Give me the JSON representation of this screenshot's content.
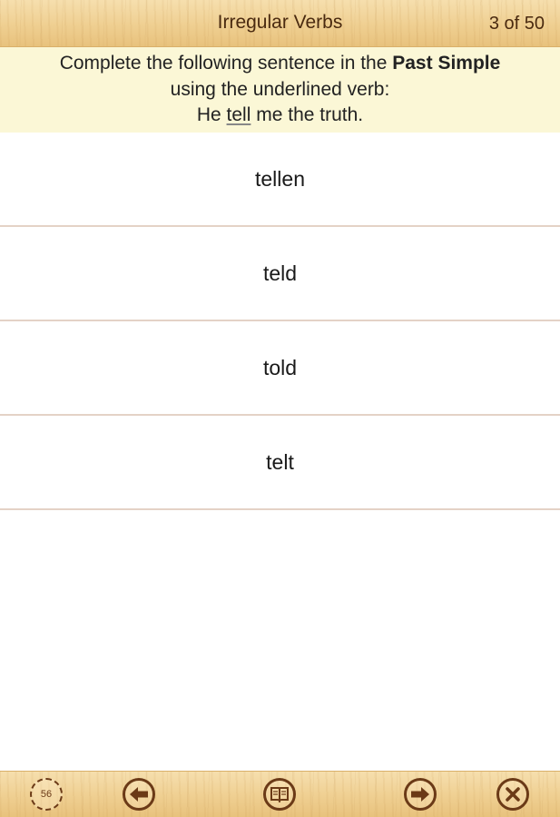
{
  "header": {
    "title": "Irregular Verbs",
    "counter": "3 of 50"
  },
  "question": {
    "prefix": "Complete the following sentence in the ",
    "tense": "Past Simple",
    "line2": "using the underlined verb:",
    "sentence_before": "He ",
    "verb": "tell",
    "sentence_after": " me the truth."
  },
  "answers": [
    "tellen",
    "teld",
    "told",
    "telt"
  ],
  "toolbar": {
    "timer_value": "56",
    "icons": [
      "timer-icon",
      "back-arrow-icon",
      "book-icon",
      "forward-arrow-icon",
      "close-icon"
    ]
  },
  "colors": {
    "wood_light": "#f6dfae",
    "wood_dark": "#e8c27d",
    "question_bg": "#fbf7d6",
    "icon_brown": "#6b3a17",
    "divider": "#e4d2c6"
  }
}
